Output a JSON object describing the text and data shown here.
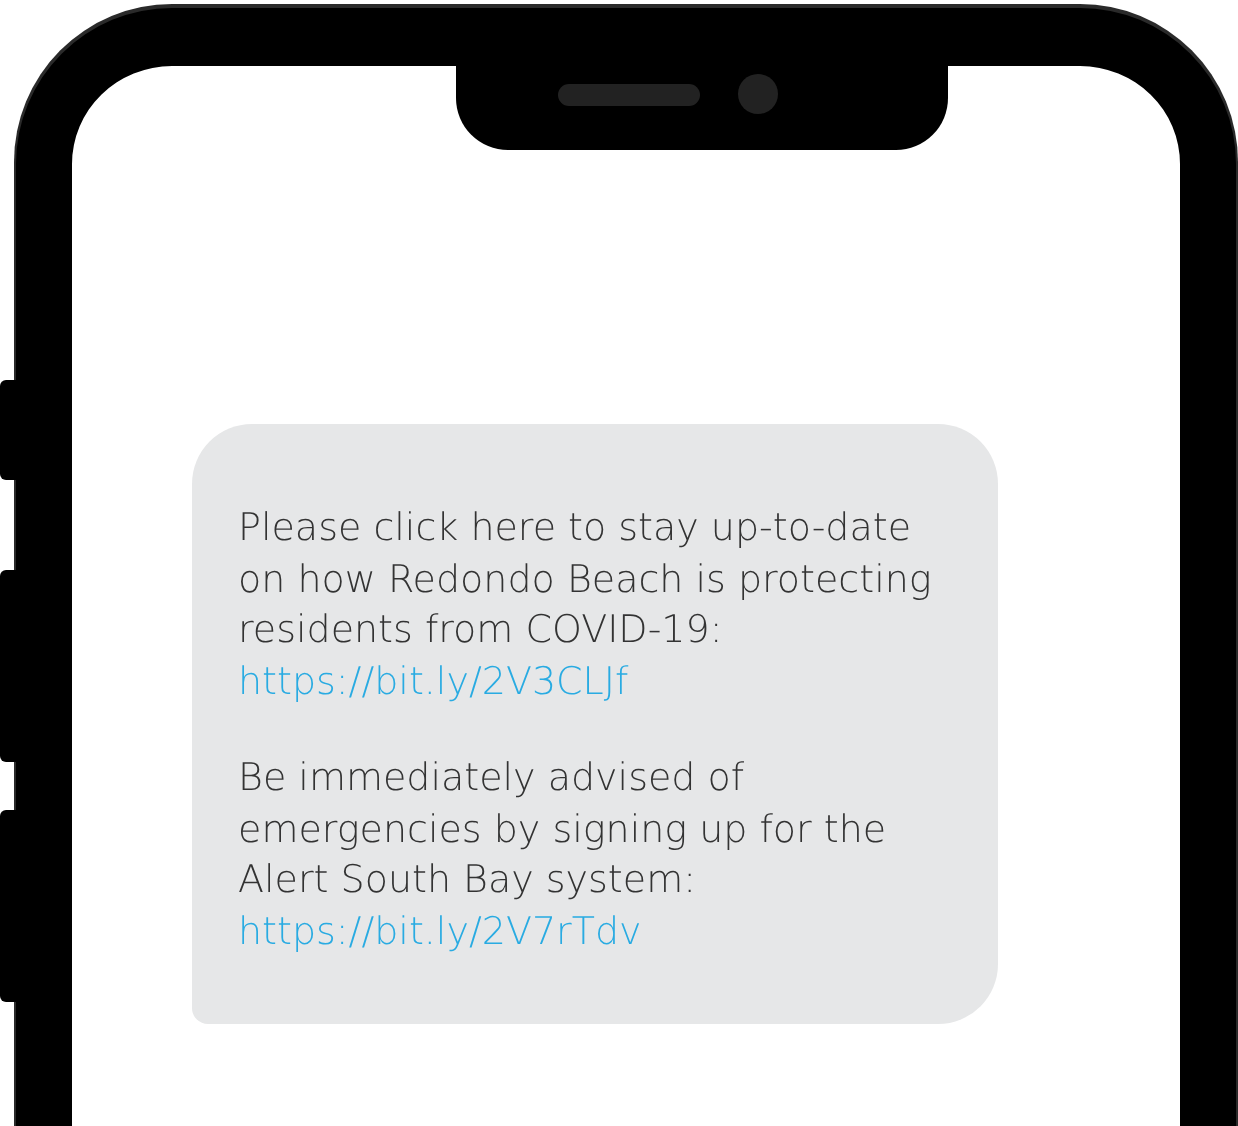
{
  "message": {
    "paragraphs": [
      {
        "text": "Please click here to stay up-to-date on how Redondo Beach is protecting residents from COVID-19:",
        "link": "https://bit.ly/2V3CLJf"
      },
      {
        "text": "Be immediately advised of emergencies by signing up for the Alert South Bay system:",
        "link": "https://bit.ly/2V7rTdv"
      }
    ]
  }
}
